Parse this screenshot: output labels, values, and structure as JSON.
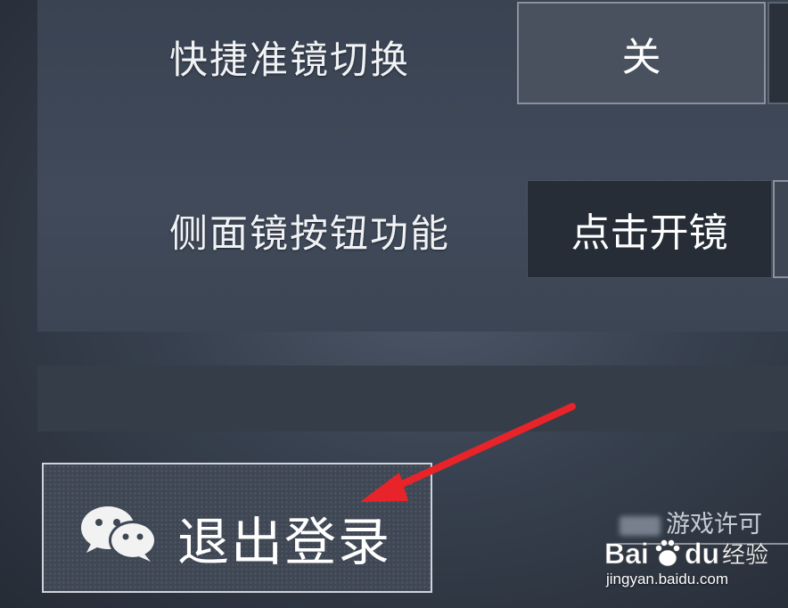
{
  "settings": {
    "rows": [
      {
        "label": "快捷准镜切换",
        "value": "关"
      },
      {
        "label": "侧面镜按钮功能",
        "value": "点击开镜"
      }
    ]
  },
  "logout": {
    "label": "退出登录",
    "icon": "wechat-icon"
  },
  "footer": {
    "license_text": "游戏许可"
  },
  "watermark": {
    "brand": "Bai du 经验",
    "url": "jingyan.baidu.com"
  },
  "colors": {
    "arrow": "#e8242a",
    "panel": "#3d4656",
    "button_border": "#cfd4da"
  }
}
